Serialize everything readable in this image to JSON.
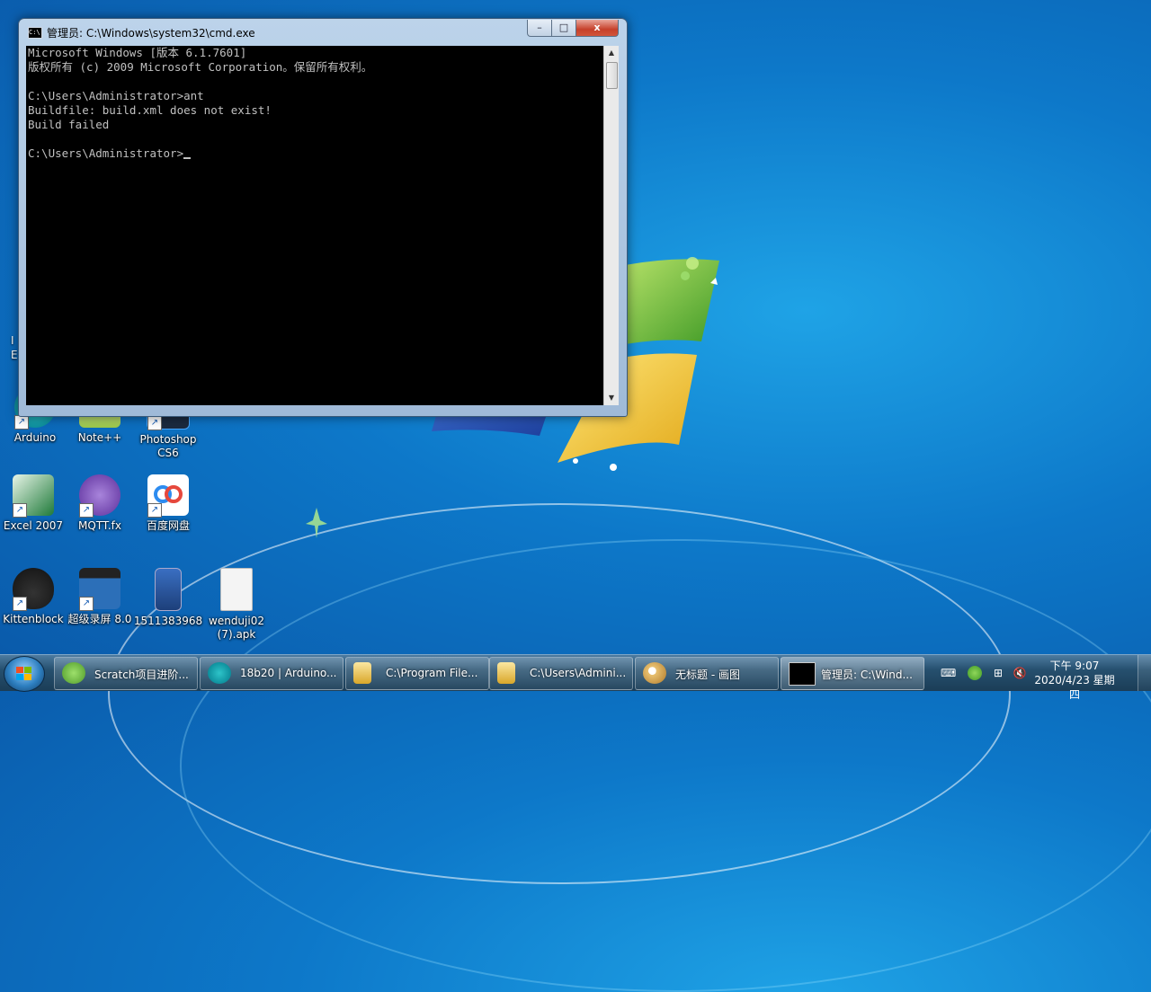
{
  "desktop": {
    "icons": [
      {
        "label": "Arduino",
        "color": "#00979c"
      },
      {
        "label": "Note++",
        "color": "#9cc84a"
      },
      {
        "label": "Photoshop CS6",
        "color": "#1b2a3f"
      },
      {
        "label": "Excel 2007",
        "color": "#1f7a3a"
      },
      {
        "label": "MQTT.fx",
        "color": "#7b4bb5"
      },
      {
        "label": "百度网盘",
        "color": "#ffffff"
      },
      {
        "label": "Kittenblock",
        "color": "#222222"
      },
      {
        "label": "超级录屏 8.0",
        "color": "#1d5fa5"
      },
      {
        "label": "1511383968",
        "color": "#1d4f9e"
      },
      {
        "label": "wenduji02 (7).apk",
        "color": "#f4f4f4"
      }
    ],
    "partial_icon_text": [
      "I",
      "E"
    ]
  },
  "window": {
    "title": "管理员: C:\\Windows\\system32\\cmd.exe",
    "icon_text": "C:\\",
    "controls": {
      "minimize": "–",
      "maximize": "□",
      "close": "x"
    },
    "console_lines": [
      "Microsoft Windows [版本 6.1.7601]",
      "版权所有 (c) 2009 Microsoft Corporation。保留所有权利。",
      "",
      "C:\\Users\\Administrator>ant",
      "Buildfile: build.xml does not exist!",
      "Build failed",
      "",
      "C:\\Users\\Administrator>"
    ],
    "scroll_up": "▲",
    "scroll_down": "▼"
  },
  "taskbar": {
    "items": [
      {
        "label": "Scratch项目进阶...",
        "icon_color": "#6cc04a",
        "active": false
      },
      {
        "label": "18b20 | Arduino...",
        "icon_color": "#00979c",
        "active": false
      },
      {
        "label": "C:\\Program File...",
        "icon_color": "#e8c45a",
        "active": false
      },
      {
        "label": "C:\\Users\\Admini...",
        "icon_color": "#e8c45a",
        "active": false
      },
      {
        "label": "无标题 - 画图",
        "icon_color": "#d9a34a",
        "active": false
      },
      {
        "label": "管理员: C:\\Wind...",
        "icon_color": "#000000",
        "active": true
      }
    ],
    "tray": {
      "keyboard_icon": "⌨",
      "network_icon": "⊞",
      "volume_icon": "🔇",
      "clock_time": "下午 9:07",
      "clock_date": "2020/4/23 星期四"
    }
  }
}
